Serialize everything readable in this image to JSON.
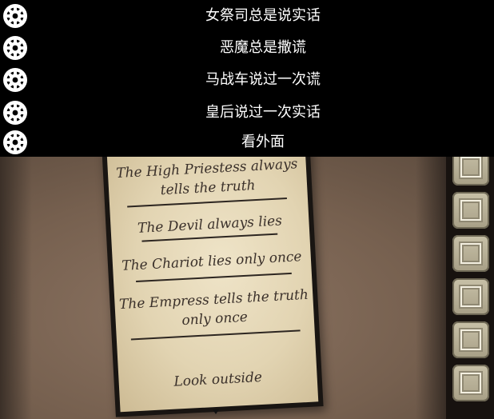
{
  "options": [
    {
      "label": "女祭司总是说实话"
    },
    {
      "label": "恶魔总是撒谎"
    },
    {
      "label": "马战车说过一次谎"
    },
    {
      "label": "皇后说过一次实话"
    },
    {
      "label": "看外面"
    }
  ],
  "note": {
    "line1": "The High Priestess always",
    "line2": "tells the truth",
    "line3": "The Devil always lies",
    "line4": "The Chariot lies only once",
    "line5": "The Empress tells the truth",
    "line6": "only once",
    "line7": "Look outside"
  },
  "inventory_slot_count": 6,
  "colors": {
    "overlay": "#000000",
    "paper": "#e6d8b6",
    "background": "#7b6553",
    "slot": "#bdb69c"
  },
  "icons": {
    "option": "gear-icon",
    "pointer": "triangle-down-icon"
  }
}
